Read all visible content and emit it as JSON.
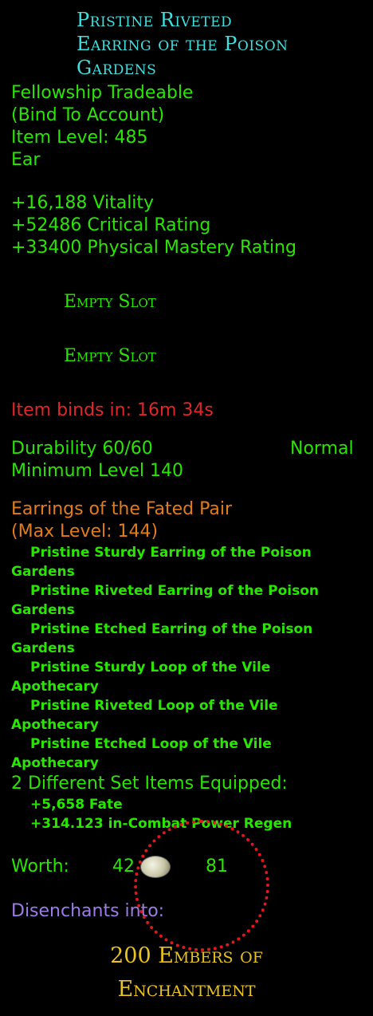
{
  "item": {
    "title_lines": [
      "Pristine Riveted",
      "Earring of the Poison",
      "Gardens"
    ],
    "tradeable": "Fellowship Tradeable",
    "bind": "(Bind To Account)",
    "item_level": "Item Level: 485",
    "slot": "Ear"
  },
  "stats": [
    "+16,188 Vitality",
    "+52486 Critical Rating",
    "+33400 Physical Mastery Rating"
  ],
  "empty_slots": [
    "Empty Slot",
    "Empty Slot"
  ],
  "binds_in": "Item binds in: 16m 34s",
  "durability": {
    "label": "Durability 60/60",
    "quality": "Normal"
  },
  "min_level": "Minimum Level 140",
  "set": {
    "name": "Earrings of the Fated Pair",
    "max_level": "(Max Level: 144)",
    "items": [
      {
        "a": "Pristine Sturdy Earring of the Poison",
        "b": "Gardens"
      },
      {
        "a": "Pristine Riveted Earring of the Poison",
        "b": "Gardens"
      },
      {
        "a": "Pristine Etched Earring of the Poison",
        "b": "Gardens"
      },
      {
        "a": "Pristine Sturdy Loop of the Vile",
        "b": "Apothecary"
      },
      {
        "a": "Pristine Riveted Loop of the Vile",
        "b": "Apothecary"
      },
      {
        "a": "Pristine Etched Loop of the Vile",
        "b": "Apothecary"
      }
    ],
    "equipped": "2 Different Set Items Equipped:",
    "bonuses": [
      "+5,658 Fate",
      "+314.123 in-Combat Power Regen"
    ]
  },
  "worth": {
    "label": "Worth:",
    "gold": "42",
    "silver": "81",
    "coin_icon": "silver-coin-icon"
  },
  "disenchant": {
    "label": "Disenchants into:",
    "result_lines": [
      "200 Embers of",
      "Enchantment"
    ]
  },
  "colors": {
    "title": "#3fe0e0",
    "text": "#29e600",
    "red": "#e0262a",
    "orange": "#e07c1c",
    "lilac": "#9d7ce8",
    "gold": "#e8c21e"
  }
}
